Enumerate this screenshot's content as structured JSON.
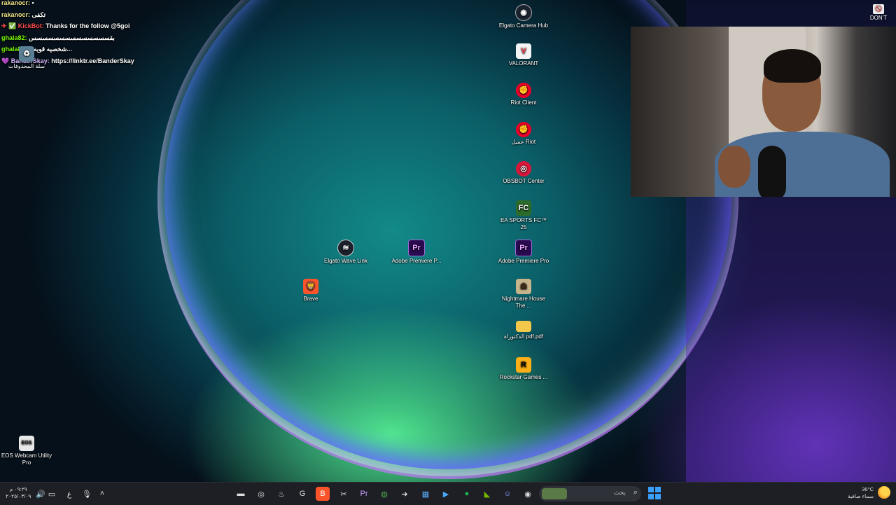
{
  "chat": [
    {
      "user": "rakanocr:",
      "msg": "• ",
      "cls": "u-rak"
    },
    {
      "user": "rakanocr:",
      "msg": "تكفى",
      "cls": "u-rak"
    },
    {
      "user": "✈ ✅ KickBot:",
      "msg": "Thanks for the follow @5goi",
      "cls": "u-kick"
    },
    {
      "user": "ghala82:",
      "msg": "بقسسسسسسسسسسسسسس",
      "cls": "u-ghala"
    },
    {
      "user": "ghala82:",
      "msg": "شخصيه قويه و...",
      "cls": "u-ghala"
    },
    {
      "user": "💜 BanderSkay:",
      "msg": "https://linktr.ee/BanderSkay",
      "cls": "u-bander"
    }
  ],
  "desktop_icons": {
    "recycle_bin": {
      "label": "سلة المحذوفات",
      "icon": "recycle-bin-icon"
    },
    "elgato_camera_hub": {
      "label": "Elgato Camera Hub",
      "icon": "elgato-camera-hub-icon"
    },
    "valorant": {
      "label": "VALORANT",
      "icon": "valorant-icon"
    },
    "riot_client": {
      "label": "Riot Client",
      "icon": "riot-client-icon"
    },
    "riot_arabic": {
      "label": "عميل Riot",
      "icon": "riot-client-icon"
    },
    "obsbot": {
      "label": "OBSBOT Center",
      "icon": "obsbot-icon"
    },
    "ea_fc": {
      "label": "EA SPORTS FC™ 25",
      "icon": "ea-fc-icon"
    },
    "premiere_right": {
      "label": "Adobe Premiere Pro",
      "icon": "premiere-pro-icon"
    },
    "nightmare_house": {
      "label": "Nightmare House The ...",
      "icon": "nightmare-house-icon"
    },
    "pdf_folder": {
      "label": "الدكتوراة pdf.pdf",
      "icon": "folder-icon"
    },
    "rockstar": {
      "label": "Rockstar Games ...",
      "icon": "rockstar-icon"
    },
    "elgato_wave_link": {
      "label": "Elgato Wave Link",
      "icon": "elgato-wave-link-icon"
    },
    "premiere_mid": {
      "label": "Adobe Premiere P...",
      "icon": "premiere-pro-icon"
    },
    "brave": {
      "label": "Brave",
      "icon": "brave-icon"
    },
    "eos_webcam": {
      "label": "EOS Webcam Utility Pro",
      "icon": "eos-webcam-icon"
    }
  },
  "overlay": {
    "dont_label": "DON'T"
  },
  "taskbar": {
    "clock_time": "٠٩:٢٩ م",
    "clock_date": "٢٠٢٥/٠٣/٠٩",
    "lang": "ع",
    "search_placeholder": "بحث",
    "weather_temp": "36°C",
    "weather_desc": "سماء صافية"
  },
  "colors": {
    "taskbar_bg": "#1d1f24",
    "accent": "#3aa0ff"
  }
}
